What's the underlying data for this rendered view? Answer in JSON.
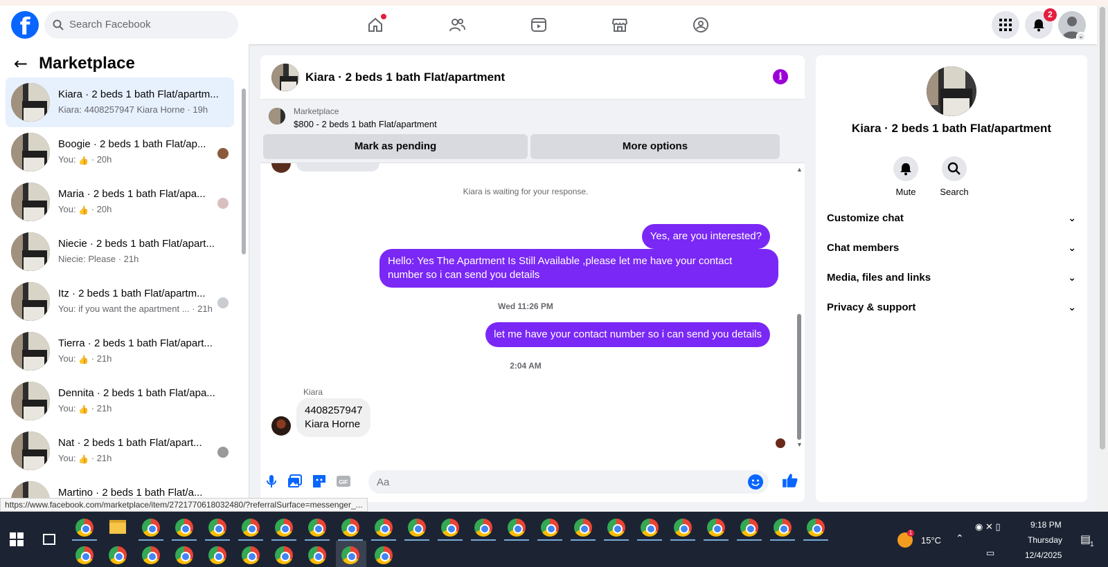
{
  "topbar": {
    "logo_letter": "f",
    "search_placeholder": "Search Facebook",
    "notifications_count": "2",
    "nav_icons": [
      "home-icon",
      "friends-icon",
      "video-icon",
      "marketplace-icon",
      "groups-icon"
    ]
  },
  "left_panel": {
    "title": "Marketplace",
    "conversations": [
      {
        "title": "Kiara · 2 beds 1 bath Flat/apartm...",
        "subtitle": "Kiara: 4408257947 Kiara Horne · 19h",
        "active": true
      },
      {
        "title": "Boogie · 2 beds 1 bath Flat/ap...",
        "subtitle_prefix": "You:",
        "subtitle_time": "20h"
      },
      {
        "title": "Maria · 2 beds 1 bath Flat/apa...",
        "subtitle_prefix": "You:",
        "subtitle_time": "20h"
      },
      {
        "title": "Niecie · 2 beds 1 bath Flat/apart...",
        "subtitle": "Niecie: Please · 21h"
      },
      {
        "title": "Itz · 2 beds 1 bath Flat/apartm...",
        "subtitle": "You: if you want the apartment ... · 21h"
      },
      {
        "title": "Tierra · 2 beds 1 bath Flat/apart...",
        "subtitle_prefix": "You:",
        "subtitle_time": "21h"
      },
      {
        "title": "Dennita · 2 beds 1 bath Flat/apa...",
        "subtitle_prefix": "You:",
        "subtitle_time": "21h"
      },
      {
        "title": "Nat · 2 beds 1 bath Flat/apart...",
        "subtitle_prefix": "You:",
        "subtitle_time": "21h"
      },
      {
        "title": "Martino · 2 beds 1 bath Flat/a...",
        "subtitle": ""
      }
    ]
  },
  "chat": {
    "title": "Kiara · 2 beds 1 bath Flat/apartment",
    "marketplace_label": "Marketplace",
    "listing": "$800 - 2 beds 1 bath Flat/apartment",
    "mark_pending": "Mark as pending",
    "more_options": "More options",
    "waiting_text": "Kiara is waiting for your response.",
    "messages": {
      "out1": "Yes, are you interested?",
      "out2": "Hello: Yes The Apartment Is Still Available ,please let me have your contact number so i can send you details",
      "time1": "Wed 11:26 PM",
      "out3": "let me have your contact number so i can send you details",
      "time2": "2:04 AM",
      "sender": "Kiara",
      "in1_line1": "4408257947",
      "in1_line2": "Kiara Horne"
    },
    "composer_placeholder": "Aa"
  },
  "right_panel": {
    "title": "Kiara · 2 beds 1 bath Flat/apartment",
    "mute": "Mute",
    "search": "Search",
    "rows": [
      "Customize chat",
      "Chat members",
      "Media, files and links",
      "Privacy & support"
    ]
  },
  "status_url": "https://www.facebook.com/marketplace/item/2721770618032480/?referralSurface=messenger_...",
  "taskbar": {
    "temperature": "15°C",
    "time": "9:18 PM",
    "day": "Thursday",
    "date": "12/4/2025",
    "notification_count": "1"
  },
  "colors": {
    "brand": "#0866ff",
    "outgoing_bubble": "#7a28f5",
    "info": "#9b00d9"
  }
}
